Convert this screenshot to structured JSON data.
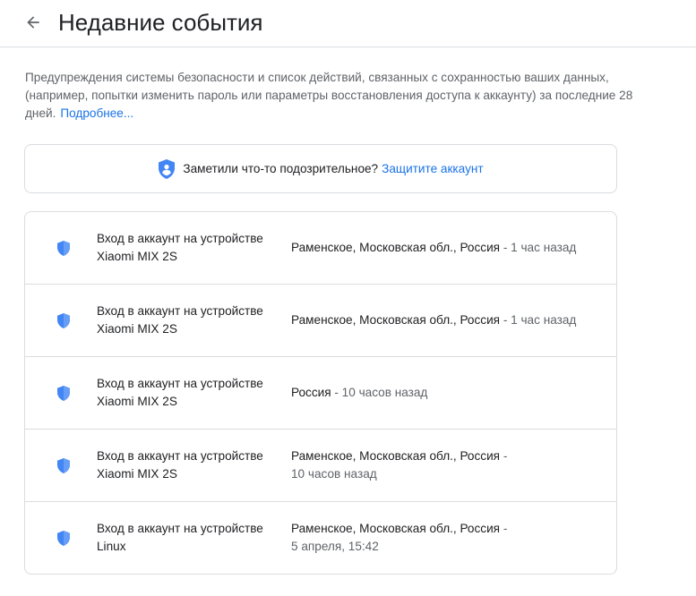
{
  "header": {
    "title": "Недавние события",
    "back_icon": "arrow-left-icon"
  },
  "intro": {
    "text": "Предупреждения системы безопасности и список действий, связанных с сохранностью ваших данных, (например, попытки изменить пароль или параметры восстановления доступа к аккаунту) за последние 28 дней.",
    "more_link": "Подробнее..."
  },
  "protect": {
    "question": "Заметили что-то подозрительное?",
    "link": "Защитите аккаунт",
    "icon": "shield-person-icon"
  },
  "events": [
    {
      "line1": "Вход в аккаунт на устройстве",
      "line2": "Xiaomi MIX 2S",
      "location": "Раменское, Московская обл., Россия",
      "separator": " - ",
      "time": "1 час назад",
      "icon": "shield-icon"
    },
    {
      "line1": "Вход в аккаунт на устройстве",
      "line2": "Xiaomi MIX 2S",
      "location": "Раменское, Московская обл., Россия",
      "separator": " - ",
      "time": "1 час назад",
      "icon": "shield-icon"
    },
    {
      "line1": "Вход в аккаунт на устройстве",
      "line2": "Xiaomi MIX 2S",
      "location": "Россия",
      "separator": " - ",
      "time": "10 часов назад",
      "icon": "shield-icon"
    },
    {
      "line1": "Вход в аккаунт на устройстве",
      "line2": "Xiaomi MIX 2S",
      "location": "Раменское, Московская обл., Россия",
      "separator": " -",
      "time": "10 часов назад",
      "icon": "shield-icon"
    },
    {
      "line1": "Вход в аккаунт на устройстве",
      "line2": "Linux",
      "location": "Раменское, Московская обл., Россия",
      "separator": " -",
      "time": "5 апреля, 15:42",
      "icon": "shield-icon"
    }
  ],
  "colors": {
    "accent": "#1a73e8",
    "shield": "#4285f4",
    "border": "#dadce0",
    "secondary_text": "#5f6368"
  }
}
